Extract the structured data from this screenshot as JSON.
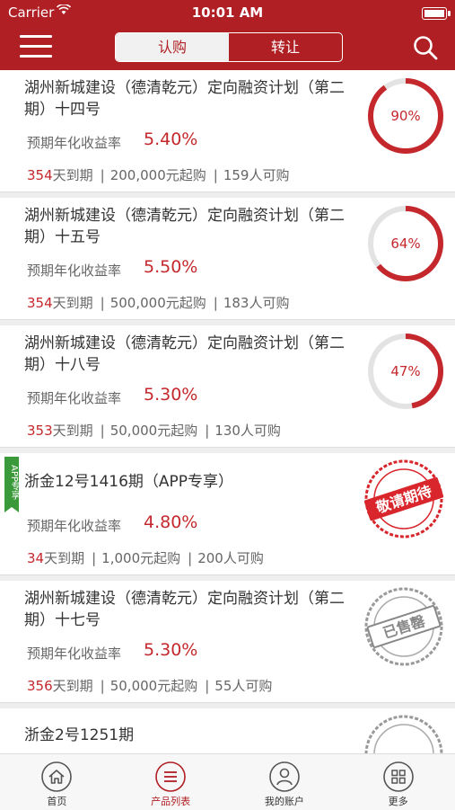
{
  "status_bar": {
    "carrier": "Carrier",
    "time": "10:01 AM"
  },
  "nav": {
    "tabs": [
      {
        "label": "认购",
        "active": true
      },
      {
        "label": "转让",
        "active": false
      }
    ]
  },
  "products": [
    {
      "title": "湖州新城建设（德清乾元）定向融资计划（第二期）十四号",
      "rate_label": "预期年化收益率",
      "rate": "5.40%",
      "days": "354",
      "days_unit": "天到期",
      "min_amount": "200,000元起购",
      "buyers": "159人可购",
      "progress": 0.9,
      "progress_text": "90%",
      "status": "ring"
    },
    {
      "title": "湖州新城建设（德清乾元）定向融资计划（第二期）十五号",
      "rate_label": "预期年化收益率",
      "rate": "5.50%",
      "days": "354",
      "days_unit": "天到期",
      "min_amount": "500,000元起购",
      "buyers": "183人可购",
      "progress": 0.64,
      "progress_text": "64%",
      "status": "ring"
    },
    {
      "title": "湖州新城建设（德清乾元）定向融资计划（第二期）十八号",
      "rate_label": "预期年化收益率",
      "rate": "5.30%",
      "days": "353",
      "days_unit": "天到期",
      "min_amount": "50,000元起购",
      "buyers": "130人可购",
      "progress": 0.47,
      "progress_text": "47%",
      "status": "ring"
    },
    {
      "title": "浙金12号1416期（APP专享）",
      "rate_label": "预期年化收益率",
      "rate": "4.80%",
      "days": "34",
      "days_unit": "天到期",
      "min_amount": "1,000元起购",
      "buyers": "200人可购",
      "badge": "APP专享",
      "stamp": "敬请期待",
      "status": "coming"
    },
    {
      "title": "湖州新城建设（德清乾元）定向融资计划（第二期）十七号",
      "rate_label": "预期年化收益率",
      "rate": "5.30%",
      "days": "356",
      "days_unit": "天到期",
      "min_amount": "50,000元起购",
      "buyers": "55人可购",
      "stamp": "已售罄",
      "status": "soldout"
    },
    {
      "title": "浙金2号1251期",
      "status": "partial"
    }
  ],
  "tabbar": [
    {
      "label": "首页",
      "icon": "home-icon",
      "active": false
    },
    {
      "label": "产品列表",
      "icon": "list-icon",
      "active": true
    },
    {
      "label": "我的账户",
      "icon": "user-icon",
      "active": false
    },
    {
      "label": "更多",
      "icon": "grid-icon",
      "active": false
    }
  ],
  "colors": {
    "brand": "#b01f24",
    "accent": "#c4282c",
    "badge_green": "#3a9a3a"
  }
}
